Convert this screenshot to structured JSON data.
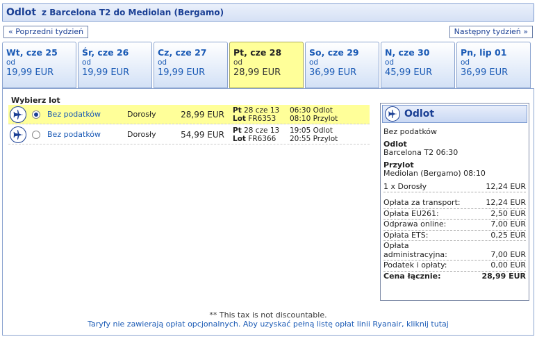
{
  "header": {
    "title": "Odlot",
    "route": "z Barcelona T2 do Mediolan (Bergamo)"
  },
  "nav": {
    "prev": "« Poprzedni tydzień",
    "next": "Następny tydzień »"
  },
  "days": [
    {
      "date": "Wt, cze 25",
      "od": "od",
      "price": "19,99 EUR",
      "selected": false
    },
    {
      "date": "Śr, cze 26",
      "od": "od",
      "price": "19,99 EUR",
      "selected": false
    },
    {
      "date": "Cz, cze 27",
      "od": "od",
      "price": "19,99 EUR",
      "selected": false
    },
    {
      "date": "Pt, cze 28",
      "od": "od",
      "price": "28,99 EUR",
      "selected": true
    },
    {
      "date": "So, cze 29",
      "od": "od",
      "price": "36,99 EUR",
      "selected": false
    },
    {
      "date": "N, cze 30",
      "od": "od",
      "price": "45,99 EUR",
      "selected": false
    },
    {
      "date": "Pn, lip 01",
      "od": "od",
      "price": "36,99 EUR",
      "selected": false
    }
  ],
  "choose_label": "Wybierz lot",
  "flights": [
    {
      "fare": "Bez podatków",
      "pax": "Dorosły",
      "price": "28,99 EUR",
      "day_label": "Pt",
      "date": "28 cze 13",
      "flight_label": "Lot",
      "flight_no": "FR6353",
      "dep": "06:30 Odlot",
      "arr": "08:10 Przylot",
      "selected": true
    },
    {
      "fare": "Bez podatków",
      "pax": "Dorosły",
      "price": "54,99 EUR",
      "day_label": "Pt",
      "date": "28 cze 13",
      "flight_label": "Lot",
      "flight_no": "FR6366",
      "dep": "19:05 Odlot",
      "arr": "20:55 Przylot",
      "selected": false
    }
  ],
  "summary": {
    "title": "Odlot",
    "fare": "Bez podatków",
    "dep_label": "Odlot",
    "dep_value": "Barcelona T2 06:30",
    "arr_label": "Przylot",
    "arr_value": "Mediolan (Bergamo) 08:10",
    "pax_line": {
      "label": "1 x Dorosły",
      "value": "12,24 EUR"
    },
    "fees": [
      {
        "label": "Opłata za transport:",
        "value": "12,24 EUR"
      },
      {
        "label": "Opłata EU261:",
        "value": "2,50 EUR"
      },
      {
        "label": "Odprawa online:",
        "value": "7,00 EUR"
      },
      {
        "label": "Opłata ETS:",
        "value": "0,25 EUR"
      },
      {
        "label": "Opłata administracyjna:",
        "value": "7,00 EUR"
      },
      {
        "label": "Podatek i opłaty:",
        "value": "0,00 EUR"
      }
    ],
    "total_label": "Cena łącznie:",
    "total_value": "28,99 EUR"
  },
  "footer": {
    "note": "** This tax is not discountable.",
    "link": "Taryfy nie zawierają opłat opcjonalnych. Aby uzyskać pełną listę opłat linii Ryanair, kliknij tutaj"
  }
}
